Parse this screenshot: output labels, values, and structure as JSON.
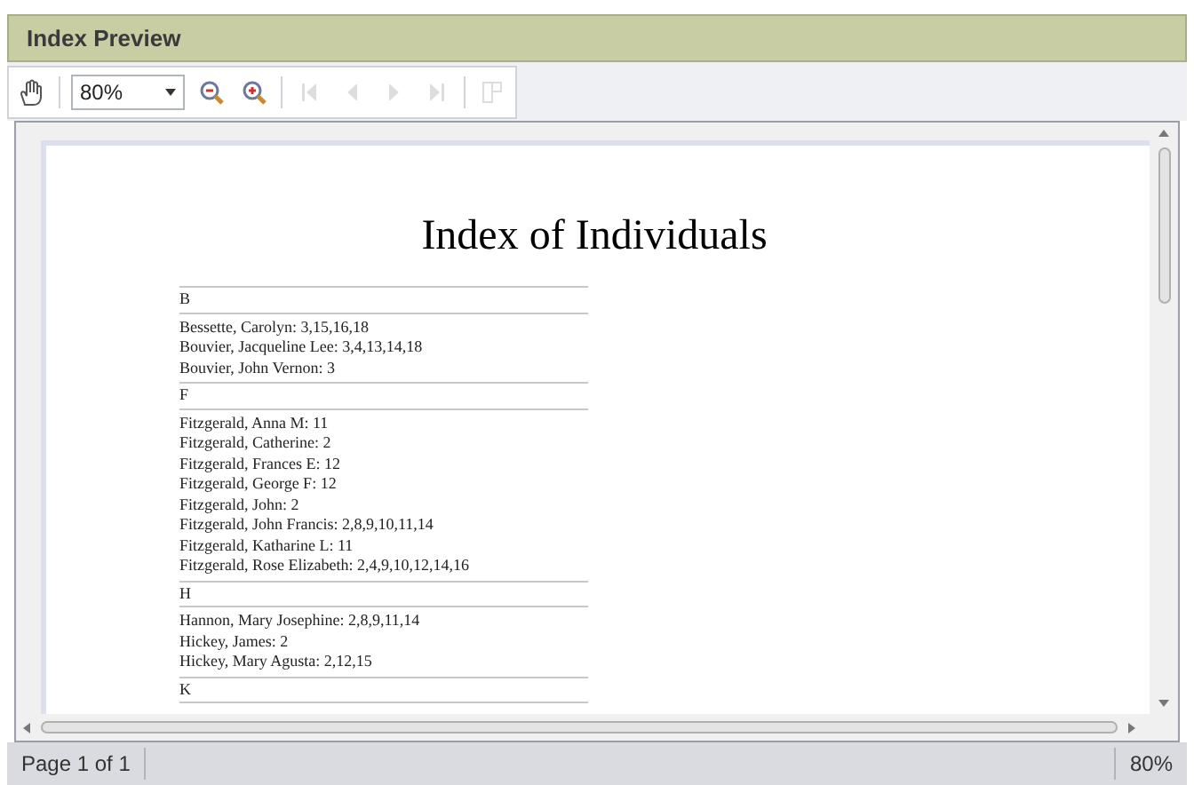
{
  "window": {
    "title": "Index Preview"
  },
  "toolbar": {
    "zoom": {
      "value": "80%"
    },
    "buttons": [
      {
        "kind": "zoom-out",
        "disabled": false
      },
      {
        "kind": "zoom-in",
        "disabled": false
      },
      {
        "kind": "first",
        "disabled": true
      },
      {
        "kind": "prev",
        "disabled": true
      },
      {
        "kind": "next",
        "disabled": true
      },
      {
        "kind": "last",
        "disabled": true
      },
      {
        "kind": "layout",
        "disabled": true
      }
    ]
  },
  "page": {
    "title": "Index of Individuals",
    "sections": [
      {
        "letter": "B",
        "entries": [
          "Bessette, Carolyn: 3,15,16,18",
          "Bouvier, Jacqueline Lee: 3,4,13,14,18",
          "Bouvier, John Vernon: 3"
        ]
      },
      {
        "letter": "F",
        "entries": [
          "Fitzgerald, Anna M: 11",
          "Fitzgerald, Catherine: 2",
          "Fitzgerald, Frances E: 12",
          "Fitzgerald, George F: 12",
          "Fitzgerald, John: 2",
          "Fitzgerald, John Francis: 2,8,9,10,11,14",
          "Fitzgerald, Katharine L: 11",
          "Fitzgerald, Rose Elizabeth: 2,4,9,10,12,14,16"
        ]
      },
      {
        "letter": "H",
        "entries": [
          "Hannon, Mary Josephine: 2,8,9,11,14",
          "Hickey, James: 2",
          "Hickey, Mary Agusta: 2,12,15"
        ]
      },
      {
        "letter": "K"
      }
    ]
  },
  "status_bar": {
    "page": "Page 1 of 1",
    "zoom": "80%"
  }
}
